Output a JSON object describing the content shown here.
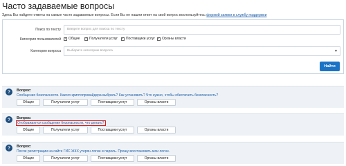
{
  "page": {
    "title": "Часто задаваемые вопросы",
    "intro_text": "Здесь Вы найдете ответы на самые часто задаваемые вопросы. Если Вы не нашли ответ на свой вопрос воспользуйтесь ",
    "intro_link": "формой заявки в службу поддержки"
  },
  "filters": {
    "search_label": "Поиск по тексту",
    "search_placeholder": "Введите вопрос для поиска по тексту",
    "category_users_label": "Категория пользователей",
    "user_categories": [
      {
        "label": "Общие",
        "checked": true
      },
      {
        "label": "Получатели услуг",
        "checked": true
      },
      {
        "label": "Поставщики услуг",
        "checked": true
      },
      {
        "label": "Органы власти",
        "checked": true
      }
    ],
    "question_category_label": "Категория вопроса",
    "question_category_placeholder": "Выберите категорию вопроса",
    "find_button": "Найти"
  },
  "questions": [
    {
      "label": "Вопрос:",
      "text": "Сообщения безопасности. Какого криптопровайдера выбрать? Как установить? Что нужно, чтобы обеспечить безопасность?",
      "tags": [
        "Общие",
        "Получатели услуг",
        "Поставщики услуг",
        "Органы власти"
      ]
    },
    {
      "label": "Вопрос:",
      "text": "Отображаются сообщения безопасности, что делать?",
      "tags": [
        "Общие",
        "Получатели услуг",
        "Поставщики услуг",
        "Органы власти"
      ]
    },
    {
      "label": "Вопрос:",
      "text": "После регистрации на сайте ГИС ЖКХ утерян логин и пароль. Прошу восстановить мои логин.",
      "tags": [
        "Общие",
        "Получатели услуг",
        "Поставщики услуг",
        "Органы власти"
      ]
    }
  ],
  "colors": {
    "accent": "#1b73c5",
    "link": "#1f5fa8",
    "icon_bg": "#1f4f7f",
    "highlight": "#e01b1b"
  },
  "icons": {
    "question": "question-icon",
    "dropdown": "chevron-down-icon",
    "check": "check-icon"
  }
}
